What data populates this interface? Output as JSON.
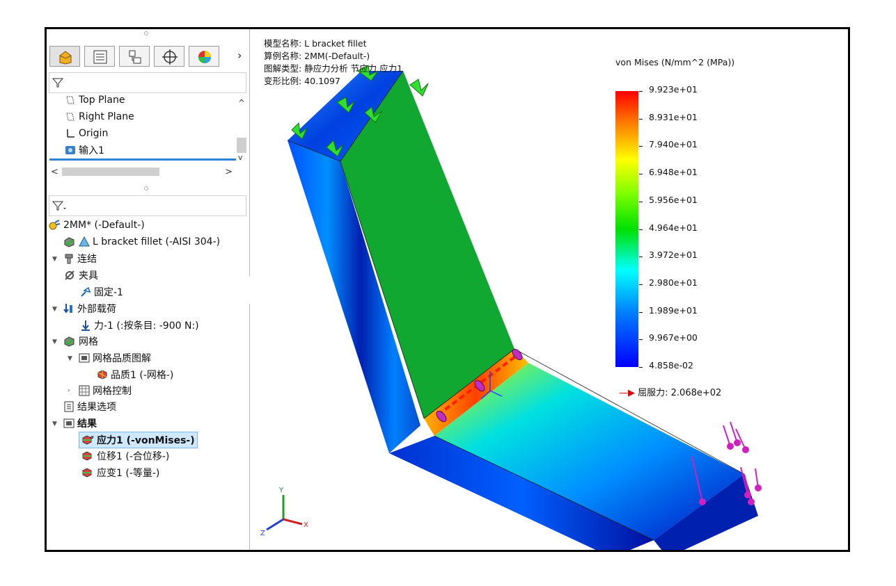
{
  "tabs": [
    "feature-manager",
    "property-manager",
    "configuration-manager",
    "dimxpert-manager",
    "display-manager"
  ],
  "feature_tree": {
    "items": [
      {
        "icon": "plane-icon",
        "label": "Top Plane"
      },
      {
        "icon": "plane-icon",
        "label": "Right Plane"
      },
      {
        "icon": "origin-icon",
        "label": "Origin"
      },
      {
        "icon": "import-body-icon",
        "label": "输入1"
      }
    ]
  },
  "study_tree": {
    "study": "2MM* (-Default-)",
    "part": "L bracket  fillet (-AISI 304-)",
    "connections": "连结",
    "fixtures": "夹具",
    "fixture_1": "固定-1",
    "external_loads": "外部载荷",
    "force_1": "力-1 (:按条目: -900 N:)",
    "mesh": "网格",
    "mesh_quality_plot": "网格品质图解",
    "quality_1": "品质1 (-网格-)",
    "mesh_control": "网格控制",
    "result_options": "结果选项",
    "results": "结果",
    "stress_1": "应力1 (-vonMises-)",
    "displacement_1": "位移1 (-合位移-)",
    "strain_1": "应变1 (-等量-)"
  },
  "info": {
    "model_name": "模型名称: L bracket  fillet",
    "study_name": "算例名称: 2MM(-Default-)",
    "plot_type": "图解类型: 静应力分析 节应力 应力1",
    "deformation_scale": "变形比例: 40.1097"
  },
  "legend": {
    "title": "von Mises (N/mm^2 (MPa))",
    "labels": [
      "9.923e+01",
      "8.931e+01",
      "7.940e+01",
      "6.948e+01",
      "5.956e+01",
      "4.964e+01",
      "3.972e+01",
      "2.980e+01",
      "1.989e+01",
      "9.967e+00",
      "4.858e-02"
    ],
    "yield": "屈服力: 2.068e+02",
    "colors": {
      "max": "#ff0000",
      "mid": "#00c000",
      "min": "#0000ff"
    }
  },
  "triad": {
    "x": "X",
    "y": "Y",
    "z": "Z"
  }
}
